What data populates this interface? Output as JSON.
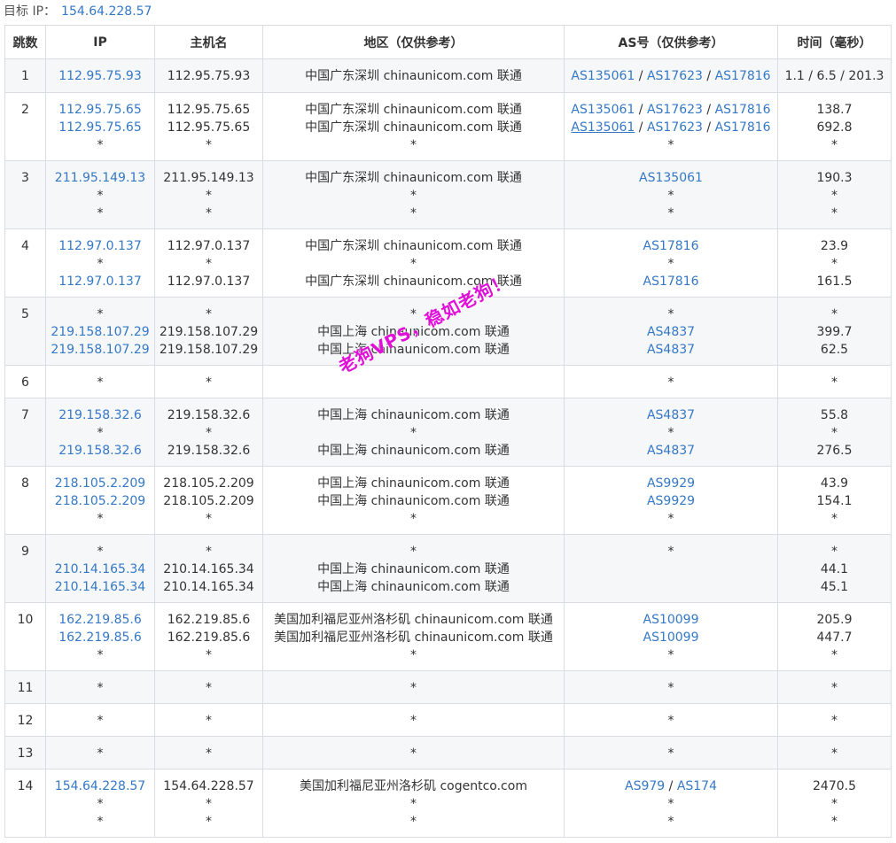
{
  "target": {
    "label": "目标 IP：",
    "ip": "154.64.228.57"
  },
  "headers": [
    "跳数",
    "IP",
    "主机名",
    "地区（仅供参考）",
    "AS号（仅供参考）",
    "时间（毫秒）"
  ],
  "rows": [
    {
      "hop": "1",
      "height": 38,
      "ip": [
        "112.95.75.93"
      ],
      "host": [
        "112.95.75.93"
      ],
      "region": [
        "中国广东深圳 chinaunicom.com 联通"
      ],
      "as": [
        [
          "AS135061",
          "AS17623",
          "AS17816"
        ]
      ],
      "time": [
        "1.1 / 6.5 / 201.3"
      ]
    },
    {
      "hop": "2",
      "height": 77,
      "ip": [
        "112.95.75.65",
        "112.95.75.65",
        "*"
      ],
      "host": [
        "112.95.75.65",
        "112.95.75.65",
        "*"
      ],
      "region": [
        "中国广东深圳 chinaunicom.com 联通",
        "中国广东深圳 chinaunicom.com 联通",
        "*"
      ],
      "as": [
        [
          "AS135061",
          "AS17623",
          "AS17816"
        ],
        [
          "AS135061",
          "AS17623",
          "AS17816"
        ],
        [
          "*"
        ]
      ],
      "time": [
        "138.7",
        "692.8",
        "*"
      ]
    },
    {
      "hop": "3",
      "height": 77,
      "ip": [
        "211.95.149.13",
        "*",
        "*"
      ],
      "host": [
        "211.95.149.13",
        "*",
        "*"
      ],
      "region": [
        "中国广东深圳 chinaunicom.com 联通",
        "*",
        "*"
      ],
      "as": [
        [
          "AS135061"
        ],
        [
          "*"
        ],
        [
          "*"
        ]
      ],
      "time": [
        "190.3",
        "*",
        "*"
      ]
    },
    {
      "hop": "4",
      "height": 77,
      "ip": [
        "112.97.0.137",
        "*",
        "112.97.0.137"
      ],
      "host": [
        "112.97.0.137",
        "*",
        "112.97.0.137"
      ],
      "region": [
        "中国广东深圳 chinaunicom.com 联通",
        "*",
        "中国广东深圳 chinaunicom.com 联通"
      ],
      "as": [
        [
          "AS17816"
        ],
        [
          "*"
        ],
        [
          "AS17816"
        ]
      ],
      "time": [
        "23.9",
        "*",
        "161.5"
      ]
    },
    {
      "hop": "5",
      "height": 77,
      "ip": [
        "*",
        "219.158.107.29",
        "219.158.107.29"
      ],
      "host": [
        "*",
        "219.158.107.29",
        "219.158.107.29"
      ],
      "region": [
        "*",
        "中国上海 chinaunicom.com 联通",
        "中国上海 chinaunicom.com 联通"
      ],
      "as": [
        [
          "*"
        ],
        [
          "AS4837"
        ],
        [
          "AS4837"
        ]
      ],
      "time": [
        "*",
        "399.7",
        "62.5"
      ]
    },
    {
      "hop": "6",
      "height": 37,
      "ip": [
        "*"
      ],
      "host": [
        "*"
      ],
      "region": [
        ""
      ],
      "as": [
        [
          "*"
        ]
      ],
      "time": [
        "*"
      ]
    },
    {
      "hop": "7",
      "height": 77,
      "ip": [
        "219.158.32.6",
        "*",
        "219.158.32.6"
      ],
      "host": [
        "219.158.32.6",
        "*",
        "219.158.32.6"
      ],
      "region": [
        "中国上海 chinaunicom.com 联通",
        "*",
        "中国上海 chinaunicom.com 联通"
      ],
      "as": [
        [
          "AS4837"
        ],
        [
          "*"
        ],
        [
          "AS4837"
        ]
      ],
      "time": [
        "55.8",
        "*",
        "276.5"
      ]
    },
    {
      "hop": "8",
      "height": 77,
      "ip": [
        "218.105.2.209",
        "218.105.2.209",
        "*"
      ],
      "host": [
        "218.105.2.209",
        "218.105.2.209",
        "*"
      ],
      "region": [
        "中国上海 chinaunicom.com 联通",
        "中国上海 chinaunicom.com 联通",
        "*"
      ],
      "as": [
        [
          "AS9929"
        ],
        [
          "AS9929"
        ],
        [
          "*"
        ]
      ],
      "time": [
        "43.9",
        "154.1",
        "*"
      ]
    },
    {
      "hop": "9",
      "height": 77,
      "ip": [
        "*",
        "210.14.165.34",
        "210.14.165.34"
      ],
      "host": [
        "*",
        "210.14.165.34",
        "210.14.165.34"
      ],
      "region": [
        "*",
        "中国上海 chinaunicom.com 联通",
        "中国上海 chinaunicom.com 联通"
      ],
      "as": [
        [
          "*"
        ]
      ],
      "time": [
        "*",
        "44.1",
        "45.1"
      ]
    },
    {
      "hop": "10",
      "height": 77,
      "ip": [
        "162.219.85.6",
        "162.219.85.6",
        "*"
      ],
      "host": [
        "162.219.85.6",
        "162.219.85.6",
        "*"
      ],
      "region": [
        "美国加利福尼亚州洛杉矶 chinaunicom.com 联通",
        "美国加利福尼亚州洛杉矶 chinaunicom.com 联通",
        "*"
      ],
      "as": [
        [
          "AS10099"
        ],
        [
          "AS10099"
        ],
        [
          "*"
        ]
      ],
      "time": [
        "205.9",
        "447.7",
        "*"
      ]
    },
    {
      "hop": "11",
      "height": 37,
      "ip": [
        "*"
      ],
      "host": [
        "*"
      ],
      "region": [
        "*"
      ],
      "as": [
        [
          "*"
        ]
      ],
      "time": [
        "*"
      ]
    },
    {
      "hop": "12",
      "height": 37,
      "ip": [
        "*"
      ],
      "host": [
        "*"
      ],
      "region": [
        "*"
      ],
      "as": [
        [
          "*"
        ]
      ],
      "time": [
        "*"
      ]
    },
    {
      "hop": "13",
      "height": 37,
      "ip": [
        "*"
      ],
      "host": [
        "*"
      ],
      "region": [
        "*"
      ],
      "as": [
        [
          "*"
        ]
      ],
      "time": [
        "*"
      ]
    },
    {
      "hop": "14",
      "height": 77,
      "ip": [
        "154.64.228.57",
        "*",
        "*"
      ],
      "host": [
        "154.64.228.57",
        "*",
        "*"
      ],
      "region": [
        "美国加利福尼亚州洛杉矶 cogentco.com",
        "*",
        "*"
      ],
      "as": [
        [
          "AS979",
          "AS174"
        ],
        [
          "*"
        ],
        [
          "*"
        ]
      ],
      "time": [
        "2470.5",
        "*",
        "*"
      ]
    }
  ],
  "underlined_as": {
    "row": 1,
    "line": 1,
    "index": 0
  },
  "watermark": "老狗VPS，稳如老狗！",
  "colors": {
    "link": "#3478c6",
    "watermark": "#e010d8",
    "border": "#d9dde2",
    "stripe": "#f6f7f8"
  }
}
